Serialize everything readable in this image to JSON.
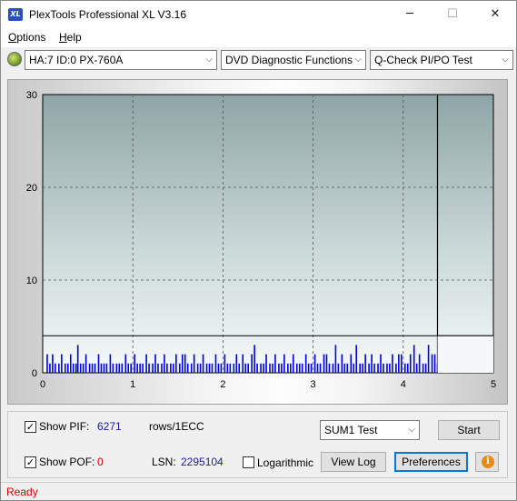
{
  "window": {
    "title": "PlexTools Professional XL V3.16",
    "icon_label": "XL"
  },
  "titlebar_buttons": {
    "minimize": "─",
    "maximize": "☐",
    "close": "✕"
  },
  "menu": {
    "options": "ptions",
    "options_mnemonic": "O",
    "help": "elp",
    "help_mnemonic": "H"
  },
  "toolbar": {
    "drive": "HA:7 ID:0  PX-760A",
    "function": "DVD Diagnostic Functions",
    "test": "Q-Check PI/PO Test",
    "arrow": "⌵"
  },
  "chart_data": {
    "type": "bar",
    "xlim": [
      0,
      5
    ],
    "ylim": [
      0,
      30
    ],
    "x_ticks": [
      "0",
      "1",
      "2",
      "3",
      "4",
      "5"
    ],
    "y_ticks": [
      "0",
      "10",
      "20",
      "30"
    ],
    "grid": true,
    "series": [
      {
        "color": "#0000dd",
        "x": [
          0.05,
          0.08,
          0.11,
          0.14,
          0.18,
          0.21,
          0.25,
          0.28,
          0.31,
          0.34,
          0.37,
          0.39,
          0.42,
          0.45,
          0.48,
          0.52,
          0.55,
          0.58,
          0.62,
          0.65,
          0.68,
          0.71,
          0.75,
          0.78,
          0.82,
          0.85,
          0.88,
          0.92,
          0.95,
          0.98,
          1.02,
          1.05,
          1.08,
          1.11,
          1.15,
          1.18,
          1.22,
          1.25,
          1.28,
          1.32,
          1.35,
          1.38,
          1.42,
          1.45,
          1.48,
          1.52,
          1.55,
          1.58,
          1.61,
          1.65,
          1.68,
          1.72,
          1.75,
          1.78,
          1.82,
          1.85,
          1.88,
          1.92,
          1.95,
          1.98,
          2.02,
          2.05,
          2.08,
          2.12,
          2.15,
          2.18,
          2.22,
          2.25,
          2.28,
          2.32,
          2.35,
          2.38,
          2.42,
          2.45,
          2.48,
          2.52,
          2.55,
          2.58,
          2.62,
          2.65,
          2.68,
          2.72,
          2.75,
          2.78,
          2.82,
          2.85,
          2.88,
          2.92,
          2.95,
          2.98,
          3.02,
          3.05,
          3.08,
          3.12,
          3.15,
          3.18,
          3.22,
          3.25,
          3.28,
          3.32,
          3.35,
          3.38,
          3.42,
          3.45,
          3.48,
          3.52,
          3.55,
          3.58,
          3.62,
          3.65,
          3.68,
          3.72,
          3.75,
          3.78,
          3.82,
          3.85,
          3.88,
          3.92,
          3.95,
          3.98,
          4.02,
          4.05,
          4.08,
          4.12,
          4.15,
          4.18,
          4.22,
          4.25,
          4.28,
          4.32,
          4.35,
          4.38
        ],
        "values": [
          2,
          1,
          2,
          1,
          1,
          2,
          1,
          1,
          2,
          1,
          1,
          3,
          1,
          1,
          2,
          1,
          1,
          1,
          2,
          1,
          1,
          1,
          2,
          1,
          1,
          1,
          1,
          2,
          1,
          1,
          2,
          1,
          1,
          1,
          2,
          1,
          1,
          2,
          1,
          1,
          2,
          1,
          1,
          1,
          2,
          1,
          2,
          2,
          1,
          1,
          2,
          1,
          1,
          2,
          1,
          1,
          1,
          2,
          1,
          1,
          2,
          1,
          1,
          1,
          2,
          1,
          2,
          1,
          1,
          2,
          3,
          1,
          1,
          1,
          2,
          1,
          1,
          2,
          1,
          1,
          2,
          1,
          1,
          2,
          1,
          1,
          1,
          2,
          1,
          1,
          2,
          1,
          1,
          2,
          2,
          1,
          1,
          3,
          1,
          2,
          1,
          1,
          2,
          1,
          3,
          1,
          1,
          2,
          1,
          2,
          1,
          1,
          2,
          1,
          1,
          1,
          2,
          1,
          2,
          2,
          1,
          1,
          2,
          3,
          1,
          2,
          1,
          1,
          3,
          2,
          2,
          1
        ]
      }
    ],
    "highlight_line_y": 4,
    "end_marker_x": 4.38
  },
  "controls": {
    "show_pif_label": "Show PIF:",
    "pif_value": "6271",
    "pif_unit": "rows/1ECC",
    "show_pof_label": "Show POF:",
    "pof_value": "0",
    "lsn_label": "LSN:",
    "lsn_value": "2295104",
    "logarithmic_label": "Logarithmic",
    "sum_test": "SUM1 Test",
    "start_label": "Start",
    "view_log_label": "View Log",
    "preferences_label": "Preferences",
    "info_glyph": "i",
    "check_glyph": "✓"
  },
  "status": {
    "text": "Ready"
  }
}
